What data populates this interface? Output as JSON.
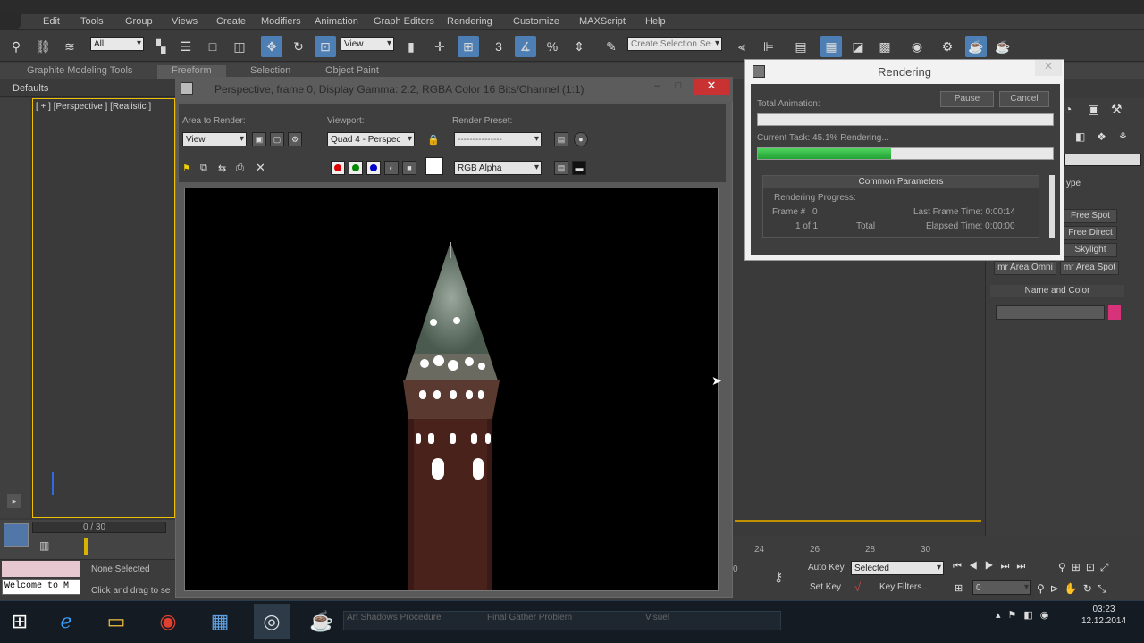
{
  "menu": [
    "Edit",
    "Tools",
    "Group",
    "Views",
    "Create",
    "Modifiers",
    "Animation",
    "Graph Editors",
    "Rendering",
    "Customize",
    "MAXScript",
    "Help"
  ],
  "toolbar": {
    "filter_value": "All",
    "view_value": "View",
    "named_selection_placeholder": "Create Selection Se"
  },
  "ribbon": {
    "tabs": [
      "Graphite Modeling Tools",
      "Freeform",
      "Selection",
      "Object Paint"
    ]
  },
  "left": {
    "defaults_label": "Defaults",
    "viewport_label": "[ + ] [Perspective ] [Realistic ]",
    "frame_counter": "0 / 30",
    "welcome": "Welcome to M",
    "none_selected": "None Selected",
    "click_drag": "Click and drag to se"
  },
  "frame_window": {
    "title": "Perspective, frame 0, Display Gamma: 2.2, RGBA Color 16 Bits/Channel (1:1)",
    "area_label": "Area to Render:",
    "area_value": "View",
    "viewport_label": "Viewport:",
    "viewport_value": "Quad 4 - Perspec",
    "preset_label": "Render Preset:",
    "preset_value": "---------------",
    "channel_value": "RGB Alpha"
  },
  "render_dialog": {
    "title": "Rendering",
    "pause": "Pause",
    "cancel": "Cancel",
    "total_animation_label": "Total Animation:",
    "total_progress": 0.0,
    "current_task": "Current Task:    45.1%  Rendering...",
    "current_progress": 0.45,
    "common_params": "Common Parameters",
    "rendering_progress": "Rendering Progress:",
    "frame_label": "Frame #",
    "frame_value": "0",
    "of_label": "1 of 1",
    "total_label": "Total",
    "last_frame_time": "Last Frame Time:  0:00:14",
    "elapsed_time": "Elapsed Time:  0:00:00"
  },
  "right_panel": {
    "type_label": "ype",
    "buttons": [
      "Free Spot",
      "Free Direct",
      "Skylight",
      "mr Area Omni",
      "mr Area Spot"
    ],
    "name_color": "Name and Color",
    "color": "#d6337a"
  },
  "anim": {
    "ticks": [
      "24",
      "26",
      "28",
      "30"
    ],
    "auto_key": "Auto Key",
    "selected": "Selected",
    "set_key": "Set Key",
    "key_filters": "Key Filters...",
    "frame_field": "0",
    "value_field": "0"
  },
  "taskbar": {
    "items": [
      "Art Shadows Procedure",
      "Final Gather Problem",
      "Visuel"
    ],
    "time": "03:23",
    "date": "12.12.2014"
  }
}
